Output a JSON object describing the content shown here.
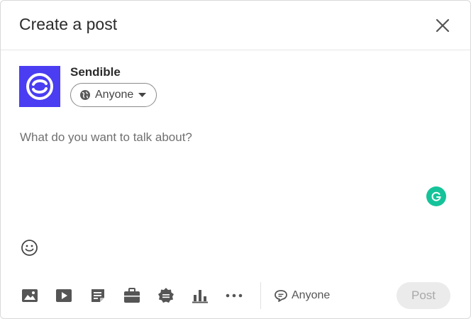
{
  "header": {
    "title": "Create a post"
  },
  "author": {
    "name": "Sendible",
    "visibility_label": "Anyone"
  },
  "composer": {
    "placeholder": "What do you want to talk about?",
    "value": ""
  },
  "toolbar": {
    "tools": [
      "image-icon",
      "video-icon",
      "document-icon",
      "job-icon",
      "celebrate-icon",
      "poll-icon",
      "more-icon"
    ],
    "comment_visibility_label": "Anyone",
    "post_label": "Post"
  },
  "colors": {
    "avatar_bg": "#4a3df2",
    "grammarly": "#15c39a",
    "post_button_bg": "#ebebeb",
    "post_button_text": "#a9a9a9"
  }
}
